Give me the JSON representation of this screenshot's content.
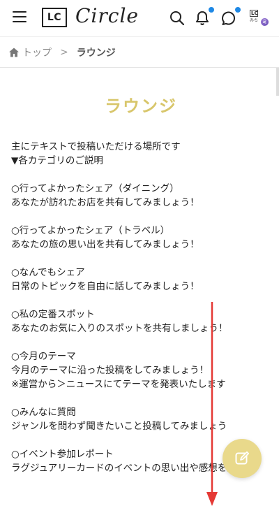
{
  "header": {
    "logo_mark": "LC",
    "logo_text": "Circle",
    "avatar": {
      "initials": "LC",
      "name": "みち",
      "badge": "ミ"
    },
    "icons": [
      "menu-icon",
      "search-icon",
      "bell-icon",
      "chat-icon",
      "avatar"
    ],
    "notification_dot_color": "#1e88e5"
  },
  "breadcrumb": {
    "home_label": "トップ",
    "separator": ">",
    "current": "ラウンジ"
  },
  "main": {
    "title": "ラウンジ",
    "title_color": "#d8c66b",
    "paragraphs": [
      [
        "主にテキストで投稿いただける場所です",
        "▼各カテゴリのご説明"
      ],
      [
        "○行ってよかったシェア（ダイニング）",
        "あなたが訪れたお店を共有してみましょう！"
      ],
      [
        "○行ってよかったシェア（トラベル）",
        "あなたの旅の思い出を共有してみましょう！"
      ],
      [
        "○なんでもシェア",
        "日常のトピックを自由に話してみましょう！"
      ],
      [
        "○私の定番スポット",
        "あなたのお気に入りのスポットを共有しましょう！"
      ],
      [
        "○今月のテーマ",
        "今月のテーマに沿った投稿をしてみましょう！",
        "※運営から＞ニュースにてテーマを発表いたします"
      ],
      [
        "○みんなに質問",
        "ジャンルを問わず聞きたいこと投稿してみましょう"
      ],
      [
        "○イベント参加レポート",
        "ラグジュアリーカードのイベントの思い出や感想を投稿し"
      ]
    ]
  },
  "fab": {
    "icon": "edit-icon",
    "color": "#e9d98b"
  },
  "annotation": {
    "arrow_color": "#e53935"
  }
}
